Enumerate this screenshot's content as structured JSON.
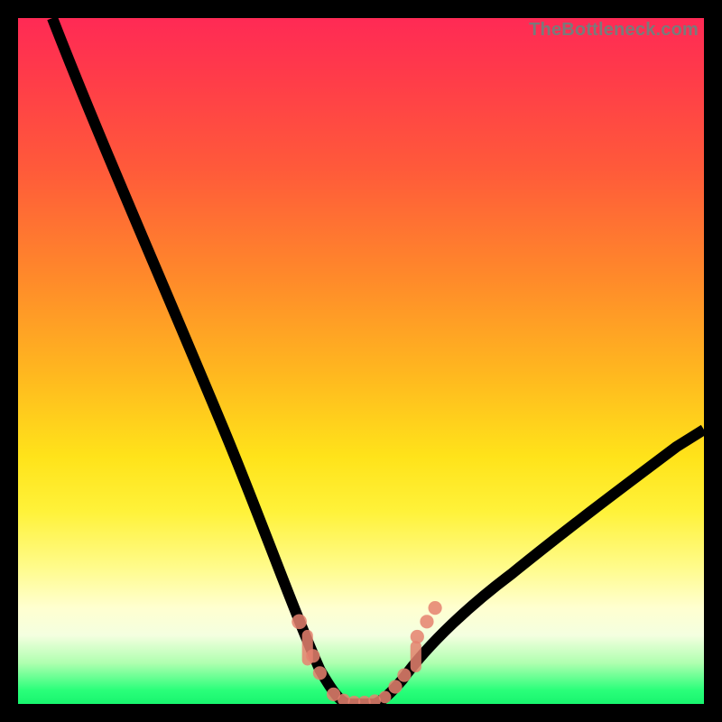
{
  "watermark": "TheBottleneck.com",
  "colors": {
    "frame": "#000000",
    "gradient_top": "#ff2a55",
    "gradient_mid": "#ffe31a",
    "gradient_bottom": "#18f56e",
    "curve": "#000000",
    "markers": "#e5816f"
  },
  "chart_data": {
    "type": "line",
    "title": "",
    "xlabel": "",
    "ylabel": "",
    "xlim": [
      0,
      100
    ],
    "ylim": [
      0,
      100
    ],
    "note": "V-shaped bottleneck curve. Minimum (≈0) around x≈46–54. Left arm rises to ≈100 near x≈5; right arm rises to ≈40 at x≈100.",
    "series": [
      {
        "name": "bottleneck-curve",
        "x": [
          5,
          10,
          15,
          20,
          25,
          30,
          35,
          38,
          41,
          44,
          46,
          48,
          50,
          52,
          54,
          57,
          60,
          65,
          70,
          75,
          80,
          85,
          90,
          95,
          100
        ],
        "y": [
          100,
          88,
          76,
          64,
          52,
          40,
          28,
          20,
          12,
          5,
          1,
          0,
          0,
          0,
          1,
          4,
          8,
          12,
          17,
          22,
          26,
          30,
          34,
          37,
          40
        ]
      }
    ],
    "markers": {
      "name": "salmon-dots",
      "approx_points_xy": [
        [
          41,
          12
        ],
        [
          42,
          9
        ],
        [
          43,
          6
        ],
        [
          44,
          4
        ],
        [
          46,
          1
        ],
        [
          48,
          0
        ],
        [
          50,
          0
        ],
        [
          52,
          0
        ],
        [
          54,
          1
        ],
        [
          56,
          3
        ],
        [
          57,
          5
        ],
        [
          59,
          8
        ],
        [
          60,
          10
        ],
        [
          61,
          13
        ]
      ]
    }
  }
}
